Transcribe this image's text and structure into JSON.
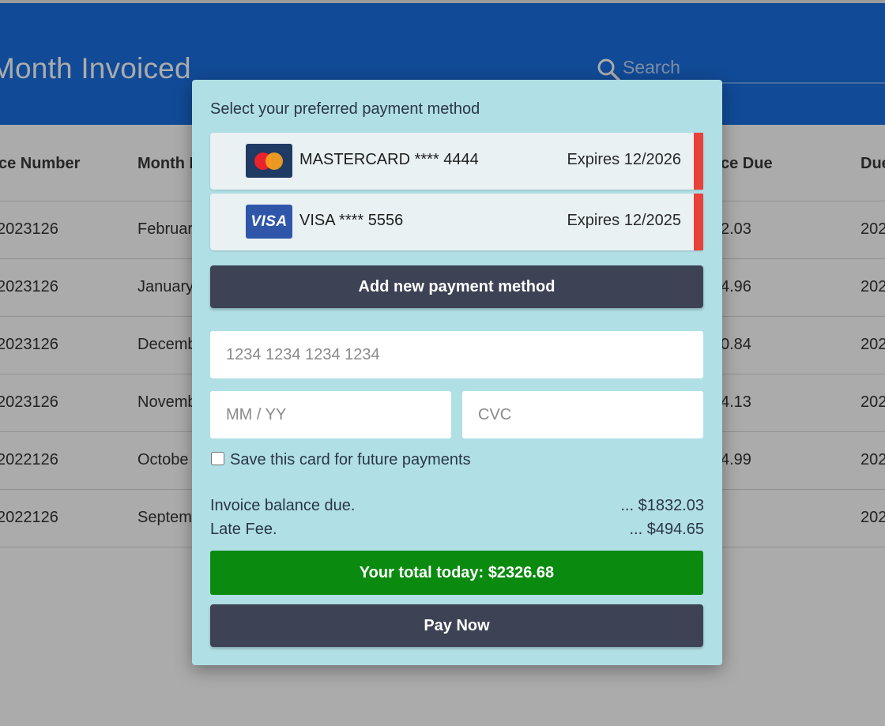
{
  "header": {
    "title": "Month Invoiced",
    "search_placeholder": "Search"
  },
  "table": {
    "columns": [
      "ce Number",
      "Month I",
      "ce Due",
      "Due"
    ],
    "rows": [
      {
        "invoice": "2023126",
        "month": "Februar",
        "balance": "2.03",
        "due": "202"
      },
      {
        "invoice": "2023126",
        "month": "January",
        "balance": "4.96",
        "due": "202"
      },
      {
        "invoice": "2023126",
        "month": "Decemb",
        "balance": "0.84",
        "due": "202"
      },
      {
        "invoice": "2023126",
        "month": "Novemb",
        "balance": "4.13",
        "due": "202"
      },
      {
        "invoice": "2022126",
        "month": "Octobe",
        "balance": "4.99",
        "due": "202"
      },
      {
        "invoice": "2022126",
        "month": "Septem",
        "balance": "",
        "due": "202"
      }
    ]
  },
  "modal": {
    "title": "Select your preferred payment method",
    "cards": [
      {
        "brand": "mastercard",
        "logo_text": "MasterCard",
        "label": "MASTERCARD **** 4444",
        "expires": "Expires 12/2026"
      },
      {
        "brand": "visa",
        "logo_text": "VISA",
        "label": "VISA **** 5556",
        "expires": "Expires 12/2025"
      }
    ],
    "add_method_label": "Add new payment method",
    "card_number_placeholder": "1234 1234 1234 1234",
    "expiry_placeholder": "MM / YY",
    "cvc_placeholder": "CVC",
    "save_card_label": "Save this card for future payments",
    "balance_label": "Invoice balance due.",
    "balance_value": "... $1832.03",
    "late_fee_label": "Late Fee.",
    "late_fee_value": "... $494.65",
    "total_label": "Your total today: $2326.68",
    "pay_label": "Pay Now"
  },
  "colors": {
    "header_blue": "#1a6fe0",
    "modal_bg": "#b0dfe5",
    "dark_button": "#3e4255",
    "total_green": "#0b8a10",
    "card_flag_red": "#e8423a"
  }
}
